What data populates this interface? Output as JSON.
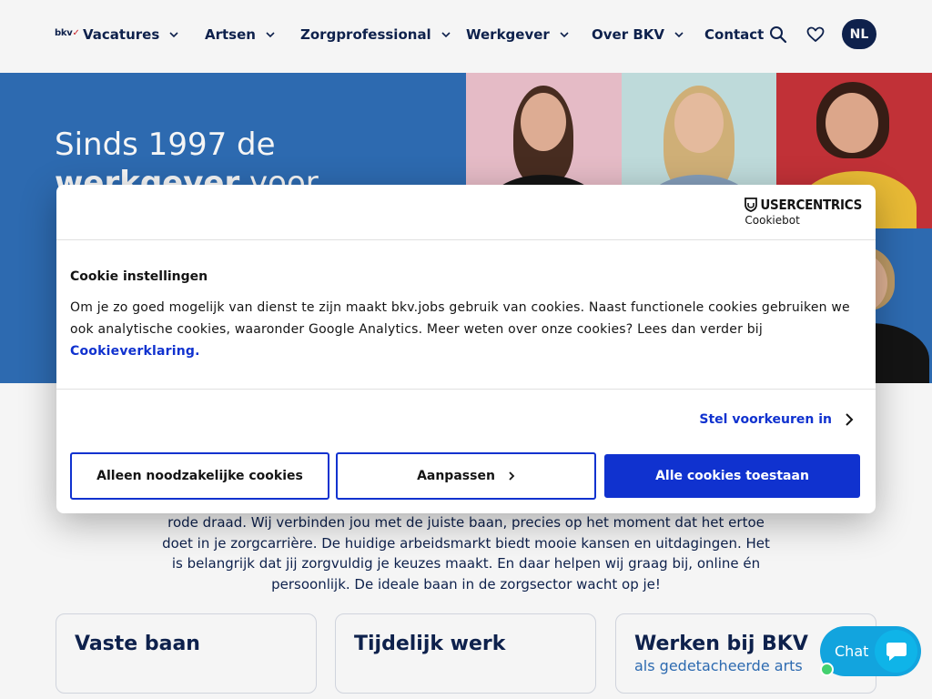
{
  "header": {
    "logo_text": "bkv",
    "nav": [
      {
        "label": "Vacatures"
      },
      {
        "label": "Artsen"
      },
      {
        "label": "Zorgprofessional"
      },
      {
        "label": "Werkgever"
      },
      {
        "label": "Over BKV"
      },
      {
        "label": "Contact"
      }
    ],
    "search_icon": "search-icon",
    "favorites_icon": "heart-icon",
    "language": "NL"
  },
  "hero": {
    "title_line1": "Sinds 1997 de",
    "title_bold": "werkgever",
    "title_rest": " voor",
    "tile_colors": [
      "#efc3cf",
      "#c6e3e3",
      "#c9343a",
      "#2f6fb8"
    ]
  },
  "cookie_dialog": {
    "brand_name": "USERCENTRICS",
    "brand_sub": "Cookiebot",
    "title": "Cookie instellingen",
    "text": "Om je zo goed mogelijk van dienst te zijn maakt bkv.jobs gebruik van cookies. Naast functionele cookies gebruiken we ook analytische cookies, waaronder Google Analytics. Meer weten over onze cookies? Lees dan verder bij ",
    "link_text": "Cookieverklaring.",
    "preferences_link": "Stel voorkeuren in",
    "buttons": {
      "necessary": "Alleen noodzakelijke cookies",
      "customize": "Aanpassen",
      "allow_all": "Alle cookies toestaan"
    }
  },
  "intro": {
    "text": "rode draad. Wij verbinden jou met de juiste baan, precies op het moment dat het ertoe doet in je zorgcarrière. De huidige arbeidsmarkt biedt mooie kansen en uitdagingen. Het is belangrijk dat jij zorgvuldig je keuzes maakt. En daar helpen wij graag bij, online én persoonlijk. De ideale baan in de zorgsector wacht op je!"
  },
  "cards": [
    {
      "title": "Vaste baan",
      "subtitle": ""
    },
    {
      "title": "Tijdelijk werk",
      "subtitle": ""
    },
    {
      "title": "Werken bij BKV",
      "subtitle": "als gedetacheerde arts"
    }
  ],
  "chat": {
    "label": "Chat"
  },
  "colors": {
    "navy": "#0f2350",
    "hero_blue": "#2f6fb8",
    "button_blue": "#1032cf",
    "chat_blue": "#12a4de",
    "status_green": "#43d16f"
  }
}
